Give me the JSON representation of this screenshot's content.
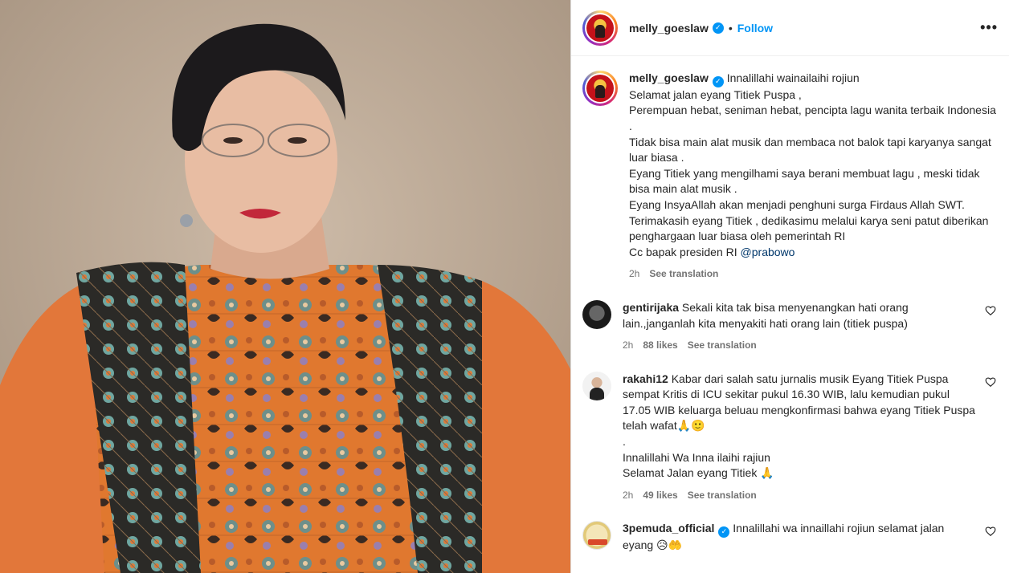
{
  "post": {
    "author": "melly_goeslaw",
    "follow_label": "Follow",
    "dot": "•",
    "more_label": "•••"
  },
  "caption": {
    "username": "melly_goeslaw",
    "lines": [
      "Innalillahi wainailaihi rojiun",
      "Selamat jalan eyang Titiek Puspa ,",
      "Perempuan hebat, seniman hebat, pencipta lagu wanita terbaik Indonesia .",
      "Tidak bisa main alat musik dan membaca not balok tapi karyanya sangat luar biasa .",
      "Eyang Titiek yang mengilhami saya berani membuat lagu , meski tidak bisa main alat musik .",
      "Eyang InsyaAllah akan menjadi penghuni surga Firdaus Allah SWT.",
      "Terimakasih eyang Titiek , dedikasimu melalui karya seni patut diberikan penghargaan luar biasa oleh pemerintah RI"
    ],
    "cc_text": "Cc bapak presiden RI ",
    "mention": "@prabowo",
    "time": "2h",
    "translate": "See translation"
  },
  "comments": [
    {
      "username": "gentirijaka",
      "text": "Sekali kita tak bisa menyenangkan hati orang lain.,janganlah kita menyakiti hati orang lain (titiek puspa)",
      "time": "2h",
      "likes": "88 likes",
      "translate": "See translation"
    },
    {
      "username": "rakahi12",
      "text": "Kabar dari salah satu jurnalis musik Eyang Titiek Puspa sempat Kritis di ICU sekitar pukul 16.30 WIB, lalu kemudian pukul 17.05 WIB keluarga beluau mengkonfirmasi bahwa eyang Titiek Puspa telah wafat🙏🙂",
      "extra1": ".",
      "extra2": "Innalillahi Wa Inna ilaihi rajiun",
      "extra3": "Selamat Jalan eyang Titiek 🙏",
      "time": "2h",
      "likes": "49 likes",
      "translate": "See translation"
    },
    {
      "username": "3pemuda_official",
      "text": "Innalillahi wa innaillahi rojiun selamat jalan eyang 😥🤲"
    }
  ],
  "icons": {
    "verified": "verified-badge-icon",
    "heart": "heart-icon",
    "more": "more-options-icon"
  },
  "colors": {
    "accent": "#0095f6",
    "muted": "#737373",
    "mention": "#00376b"
  }
}
